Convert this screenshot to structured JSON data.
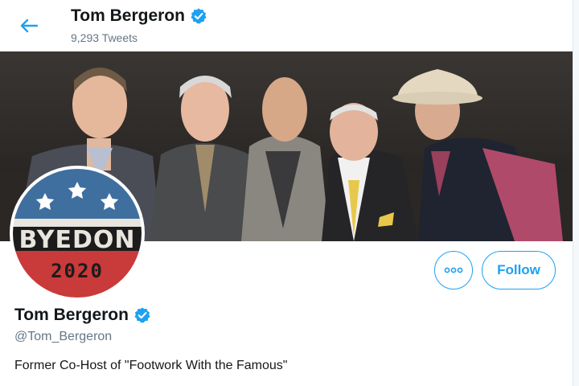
{
  "header": {
    "name": "Tom Bergeron",
    "tweet_count": "9,293 Tweets"
  },
  "avatar": {
    "text_main": "BYEDON",
    "text_year": "2020"
  },
  "actions": {
    "follow_label": "Follow"
  },
  "profile": {
    "name": "Tom Bergeron",
    "handle": "@Tom_Bergeron",
    "bio": "Former Co-Host of \"Footwork With the Famous\""
  },
  "colors": {
    "accent": "#1da1f2",
    "text": "#14171a",
    "muted": "#657786",
    "avatar_blue": "#3f6f9f",
    "avatar_red": "#c93a3a"
  }
}
